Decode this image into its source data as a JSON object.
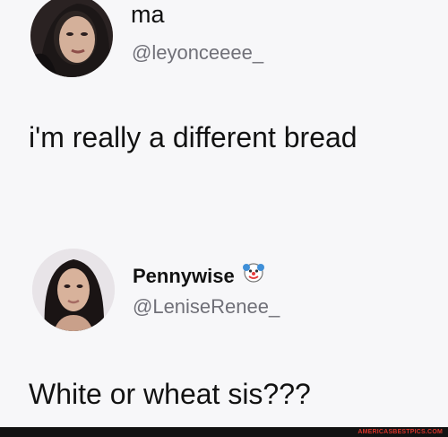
{
  "tweets": [
    {
      "display_name": "ma",
      "handle": "@leyonceeee_",
      "text": "i'm really a different bread",
      "avatar_icon": "profile-photo"
    },
    {
      "display_name": "Pennywise",
      "name_emoji": "clown-face-icon",
      "handle": "@LeniseRenee_",
      "text": "White or wheat sis???",
      "avatar_icon": "profile-photo"
    }
  ],
  "footer": {
    "watermark": "AMERICASBESTPICS.COM",
    "bar_color": "#121212",
    "watermark_color": "#d8342a"
  }
}
